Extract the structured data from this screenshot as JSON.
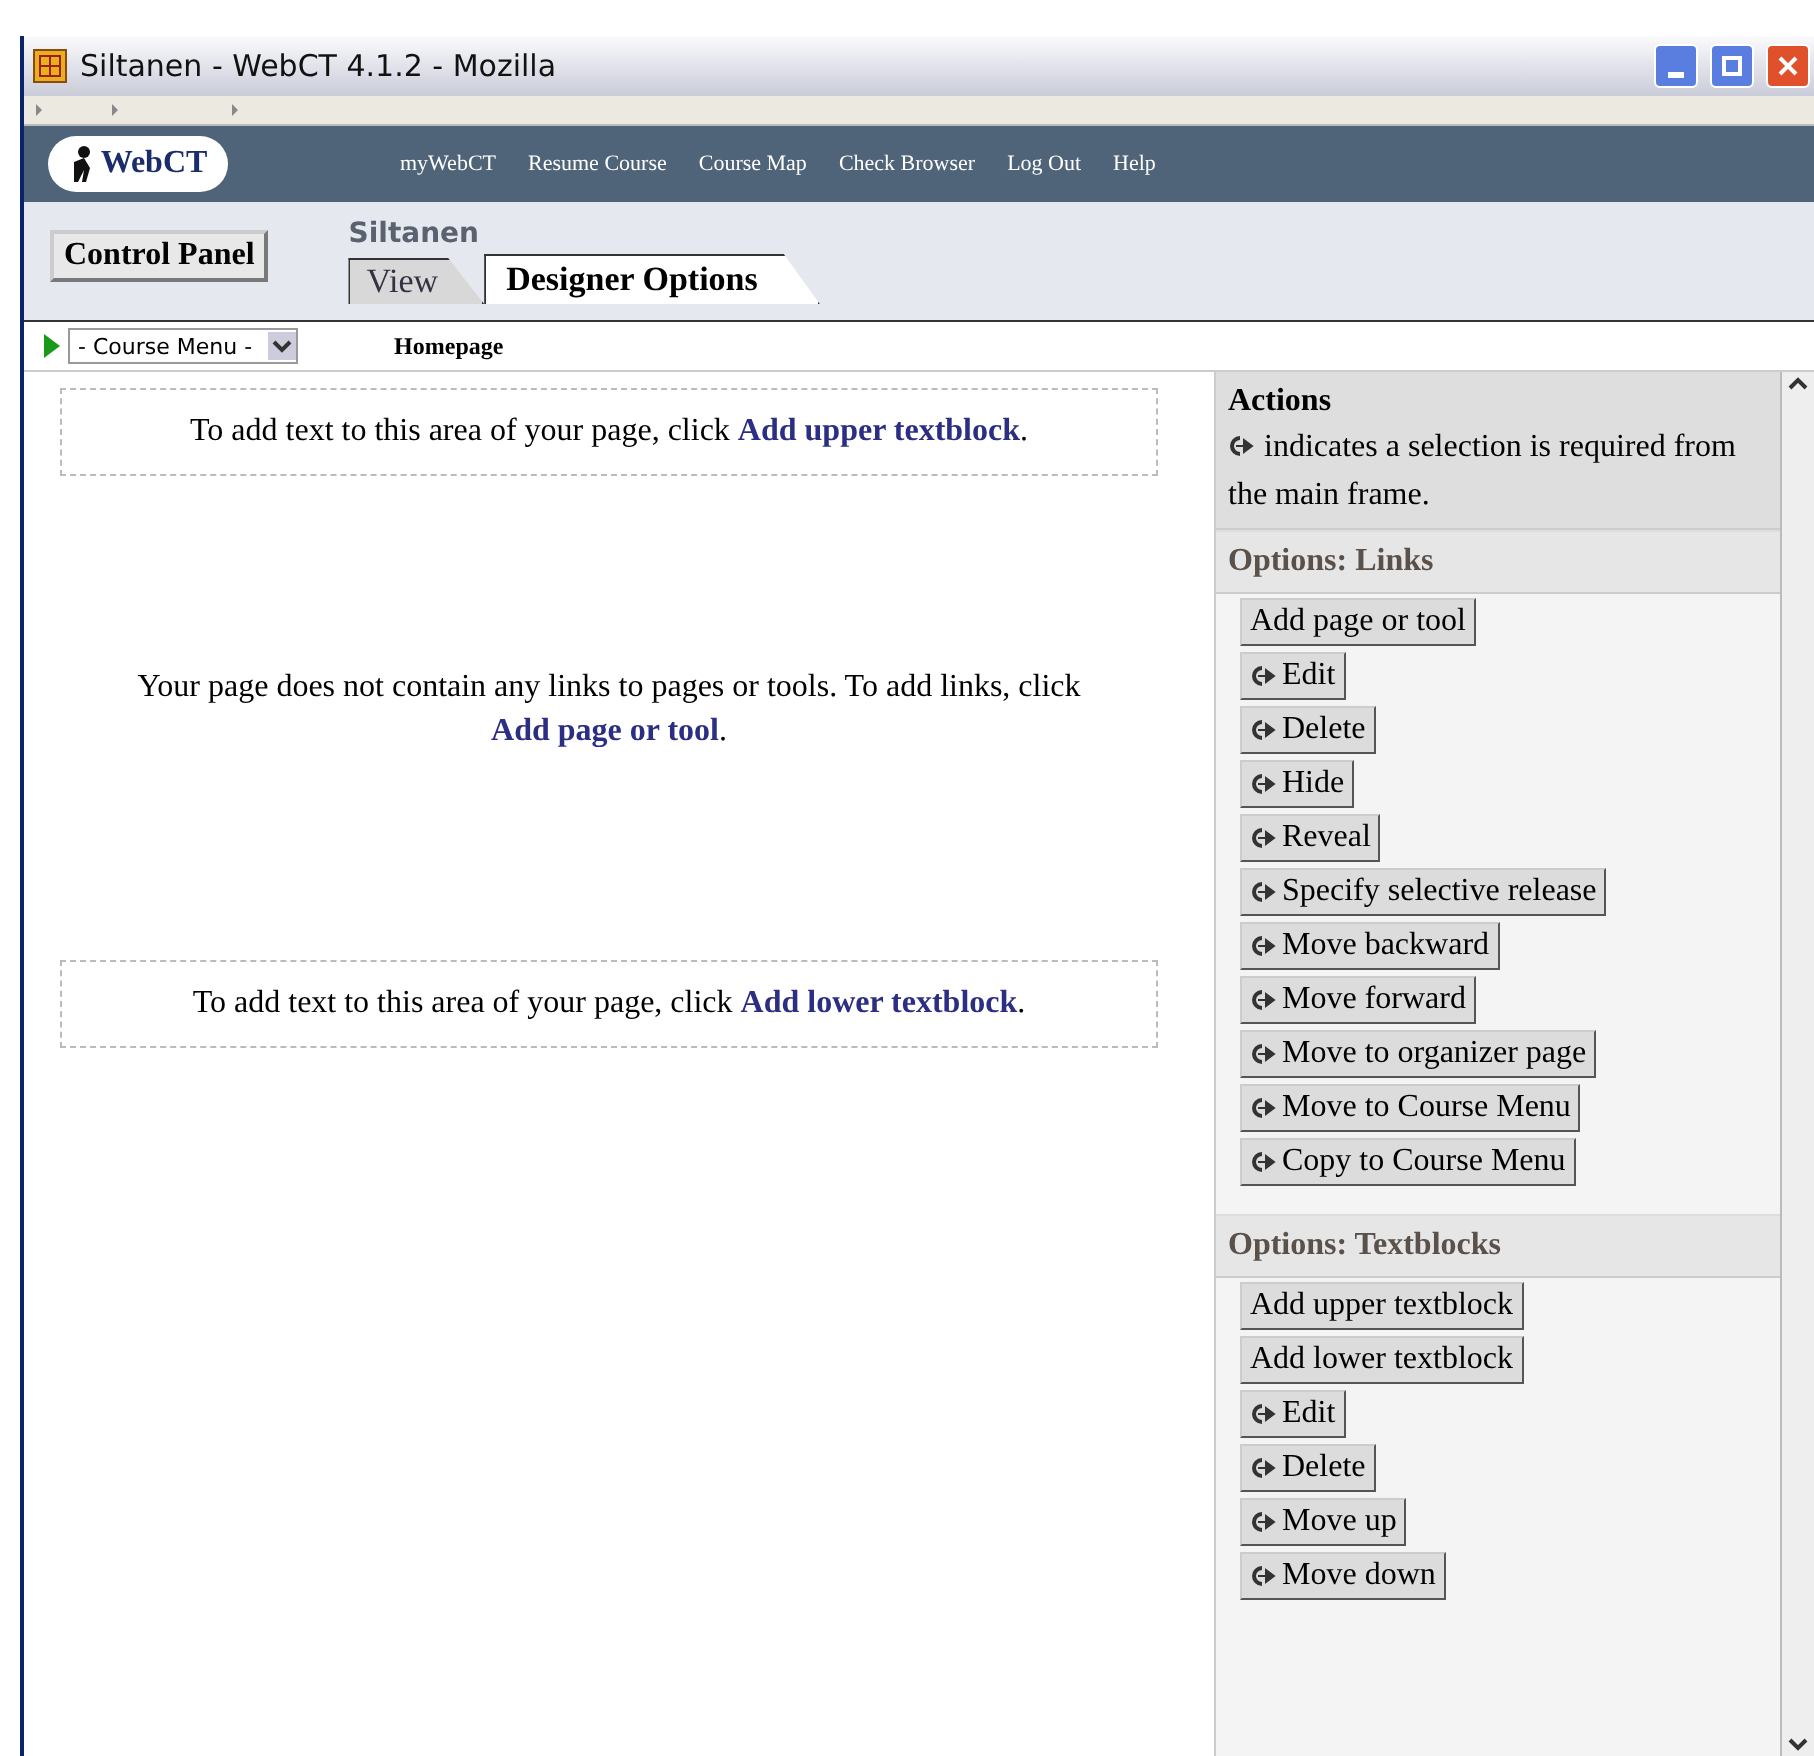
{
  "window": {
    "title": "Siltanen - WebCT 4.1.2 - Mozilla"
  },
  "nav_links": [
    "myWebCT",
    "Resume Course",
    "Course Map",
    "Check Browser",
    "Log Out",
    "Help"
  ],
  "logo": "WebCT",
  "control_panel": "Control Panel",
  "course_title": "Siltanen",
  "tabs": [
    {
      "label": "View",
      "selected": false
    },
    {
      "label": "Designer Options",
      "selected": true
    }
  ],
  "course_menu": {
    "value": "- Course Menu -"
  },
  "breadcrumb": "Homepage",
  "main": {
    "upper": {
      "text": "To add text to this area of your page, click ",
      "link": "Add upper textblock",
      "after": "."
    },
    "links_note": {
      "text": "Your page does not contain any links to pages or tools. To add links, click ",
      "link": "Add page or tool",
      "after": "."
    },
    "lower": {
      "text": "To add text to this area of your page, click ",
      "link": "Add lower textblock",
      "after": "."
    }
  },
  "actions": {
    "title": "Actions",
    "note": "indicates a selection is required from the main frame.",
    "sections": [
      {
        "title": "Options: Links",
        "buttons": [
          {
            "label": "Add page or tool",
            "requires_selection": false
          },
          {
            "label": "Edit",
            "requires_selection": true
          },
          {
            "label": "Delete",
            "requires_selection": true
          },
          {
            "label": "Hide",
            "requires_selection": true
          },
          {
            "label": "Reveal",
            "requires_selection": true
          },
          {
            "label": "Specify selective release",
            "requires_selection": true
          },
          {
            "label": "Move backward",
            "requires_selection": true
          },
          {
            "label": "Move forward",
            "requires_selection": true
          },
          {
            "label": "Move to organizer page",
            "requires_selection": true
          },
          {
            "label": "Move to Course Menu",
            "requires_selection": true
          },
          {
            "label": "Copy to Course Menu",
            "requires_selection": true
          }
        ]
      },
      {
        "title": "Options: Textblocks",
        "buttons": [
          {
            "label": "Add upper textblock",
            "requires_selection": false
          },
          {
            "label": "Add lower textblock",
            "requires_selection": false
          },
          {
            "label": "Edit",
            "requires_selection": true
          },
          {
            "label": "Delete",
            "requires_selection": true
          },
          {
            "label": "Move up",
            "requires_selection": true
          },
          {
            "label": "Move down",
            "requires_selection": true
          }
        ]
      }
    ]
  }
}
